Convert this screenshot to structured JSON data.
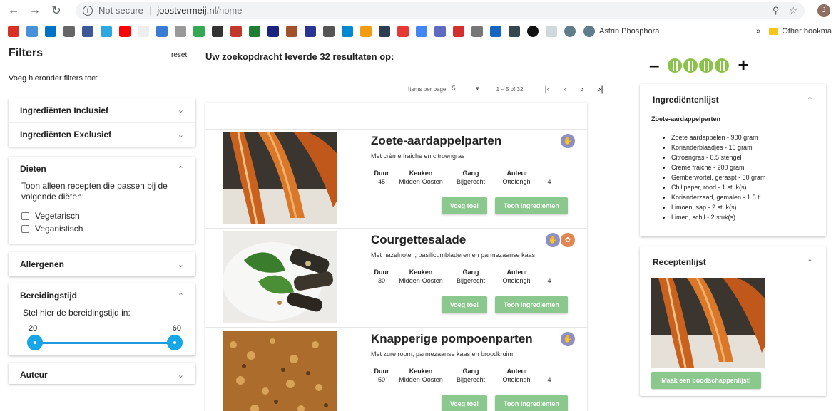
{
  "browser": {
    "security": "Not secure",
    "host": "joostvermeij.nl",
    "path": "/home",
    "avatar_letter": "J",
    "bookmark_named": "Astrin Phosphora",
    "other_bookmarks": "Other bookma",
    "more": "»"
  },
  "filters": {
    "title": "Filters",
    "reset": "reset",
    "subtitle": "Voeg hieronder filters toe:",
    "ingr_incl": "Ingrediënten Inclusief",
    "ingr_excl": "Ingrediënten Exclusief",
    "diets_title": "Dieten",
    "diets_text": "Toon alleen recepten die passen bij de volgende diëten:",
    "diet_options": [
      "Vegetarisch",
      "Veganistisch"
    ],
    "allergens": "Allergenen",
    "prep_title": "Bereidingstijd",
    "prep_text": "Stel hier de bereidingstijd in:",
    "prep_min": "20",
    "prep_max": "60",
    "author": "Auteur"
  },
  "results": {
    "heading": "Uw zoekopdracht leverde 32 resultaten op:",
    "items_per_page_label": "Items per page:",
    "items_per_page": "5",
    "range": "1 – 5 of 32",
    "meta_headers": [
      "Duur",
      "Keuken",
      "Gang",
      "Auteur"
    ],
    "add_label": "Voeg toe!",
    "show_label": "Toon ingredienten",
    "recipes": [
      {
        "title": "Zoete-aardappelparten",
        "subtitle": "Met crème fraiche en citroengras",
        "duur": "45",
        "keuken": "Midden-Oosten",
        "gang": "Bijgerecht",
        "auteur": "Ottolenghi",
        "extra": "4"
      },
      {
        "title": "Courgettesalade",
        "subtitle": "Met hazelnoten, basilicumbladeren en parmezaanse kaas",
        "duur": "30",
        "keuken": "Midden-Oosten",
        "gang": "Bijgerecht",
        "auteur": "Ottolenghi",
        "extra": "4"
      },
      {
        "title": "Knapperige pompoenparten",
        "subtitle": "Met zure room, parmezaanse kaas en broodkruim",
        "duur": "50",
        "keuken": "Midden-Oosten",
        "gang": "Bijgerecht",
        "auteur": "Ottolenghi",
        "extra": "4"
      }
    ]
  },
  "servings": {
    "minus": "–",
    "plus": "+",
    "count": 4
  },
  "ingredients": {
    "title": "Ingrediëntenlijst",
    "recipe": "Zoete-aardappelparten",
    "items": [
      "Zoete aardappelen - 900 gram",
      "Korianderblaadjes - 15 gram",
      "Citroengras - 0.5 stengel",
      "Crème fraiche - 200 gram",
      "Gemberwortel, geraspt - 50 gram",
      "Chilipeper, rood - 1 stuk(s)",
      "Korianderzaad, gemalen - 1.5 tl",
      "Limoen, sap - 2 stuk(s)",
      "Limen, schil - 2 stuk(s)"
    ]
  },
  "recipelist": {
    "title": "Receptenlijst",
    "button": "Maak een boodschappenlijst!"
  },
  "colors": {
    "accent_green": "#8bc88d",
    "slider_blue": "#16a7e8",
    "diet_purple": "#8e8fc3",
    "diet_orange": "#e2874f"
  }
}
